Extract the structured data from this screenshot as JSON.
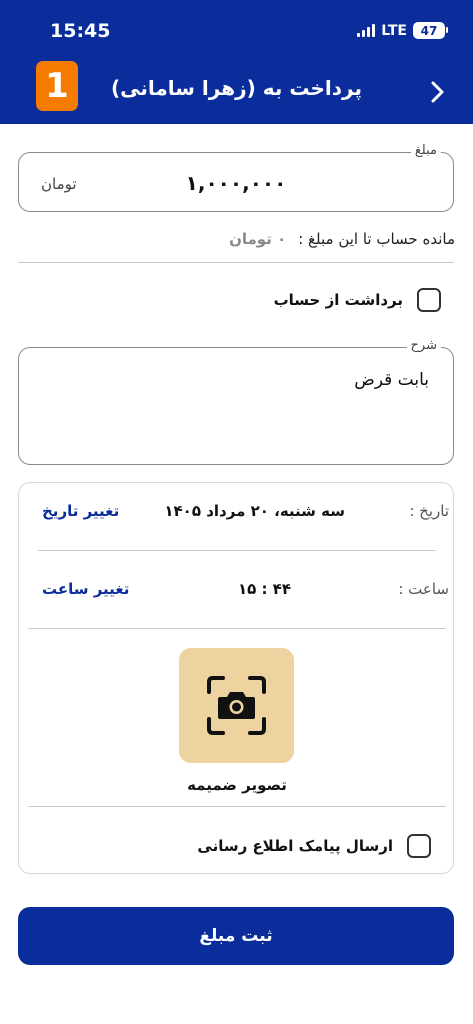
{
  "status_bar": {
    "time": "15:45",
    "network": "LTE",
    "battery": "47"
  },
  "header": {
    "title": "پرداخت به (زهرا سامانی)",
    "logo_text": "1"
  },
  "amount": {
    "legend": "مبلغ",
    "value": "۱,۰۰۰,۰۰۰",
    "unit": "تومان"
  },
  "remaining": {
    "label": "مانده حساب تا این مبلغ :",
    "value": "۰ تومان"
  },
  "withdraw": {
    "label": "برداشت از حساب",
    "checked": false
  },
  "description": {
    "legend": "شرح",
    "value": "بابت قرض"
  },
  "date": {
    "label": "تاریخ :",
    "value": "سه شنبه، ۲۰ مرداد ۱۴۰۵",
    "action": "تغییر تاریخ"
  },
  "time": {
    "label": "ساعت :",
    "value": "۱۵ : ۴۴",
    "action": "تغییر ساعت"
  },
  "attachment": {
    "label": "تصویر ضمیمه",
    "icon": "camera-icon"
  },
  "sms": {
    "label": "ارسال پیامک اطلاع رسانی",
    "checked": false
  },
  "submit": {
    "label": "ثبت مبلغ"
  },
  "colors": {
    "primary": "#0b2d9c",
    "accent": "#f57c00",
    "attachment_bg": "#ecd3a0"
  }
}
